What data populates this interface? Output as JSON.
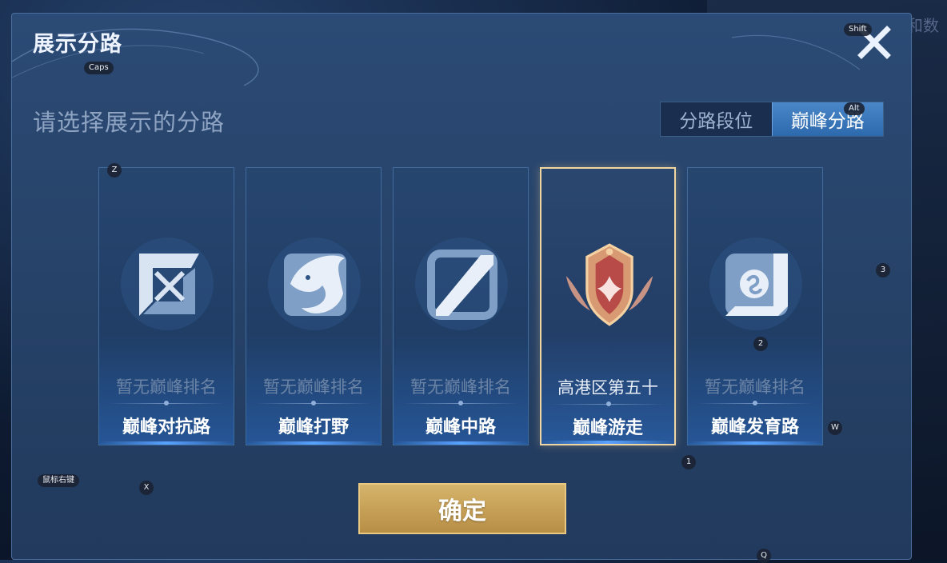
{
  "dialog": {
    "title": "展示分路",
    "prompt": "请选择展示的分路",
    "close_icon": "close-icon"
  },
  "tabs": [
    {
      "label": "分路段位",
      "selected": false
    },
    {
      "label": "巅峰分路",
      "selected": true
    }
  ],
  "cards": [
    {
      "rank": "暂无巅峰排名",
      "role": "巅峰对抗路",
      "icon": "sword-icon",
      "selected": false
    },
    {
      "rank": "暂无巅峰排名",
      "role": "巅峰打野",
      "icon": "dragon-icon",
      "selected": false
    },
    {
      "rank": "暂无巅峰排名",
      "role": "巅峰中路",
      "icon": "lane-slash-icon",
      "selected": false
    },
    {
      "rank": "高港区第五十",
      "role": "巅峰游走",
      "icon": "winged-shield-icon",
      "selected": true
    },
    {
      "rank": "暂无巅峰排名",
      "role": "巅峰发育路",
      "icon": "target-icon",
      "selected": false
    }
  ],
  "confirm_label": "确定",
  "background_text": "全和数",
  "key_hints": {
    "caps": "Caps",
    "shift": "Shift",
    "alt": "Alt",
    "z": "Z",
    "three": "3",
    "two": "2",
    "w": "W",
    "one": "1",
    "x": "X",
    "mouse_right": "鼠标右键",
    "q": "Q"
  },
  "colors": {
    "panel": "#274369",
    "accent_blue": "#3d7bc0",
    "selected_border": "#f0d7a2",
    "confirm_gold": "#c9a257"
  }
}
